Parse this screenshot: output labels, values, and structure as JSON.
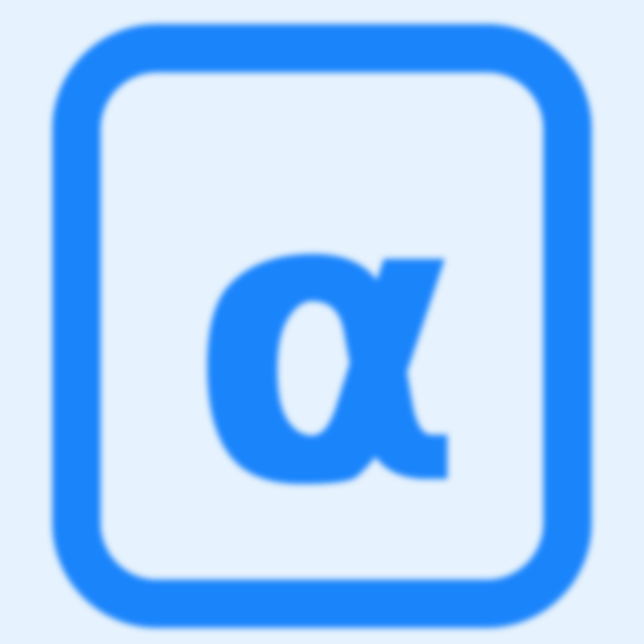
{
  "icon": {
    "name": "alpha-box-icon",
    "glyph": "α",
    "colors": {
      "background": "#e6f2fd",
      "stroke": "#1a84fb",
      "glyph": "#1a84fb"
    }
  }
}
